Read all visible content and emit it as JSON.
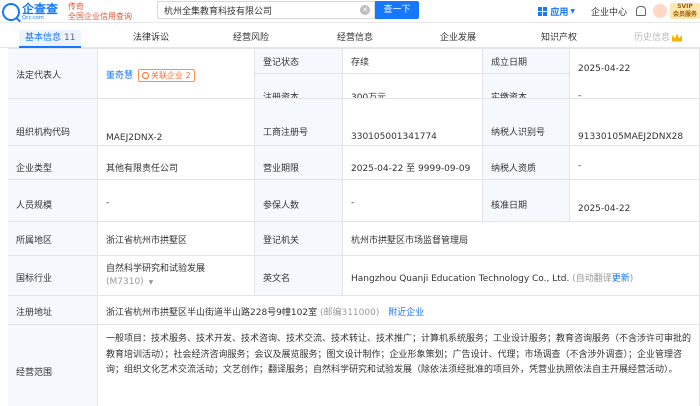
{
  "header": {
    "logo_cn": "企查查",
    "logo_en": "Qcc.com",
    "slogan_line1": "传奇",
    "slogan_line2": "全国企业信用查询",
    "search_value": "杭州全集教育科技有限公司",
    "clear_symbol": "✕",
    "search_button": "查一下",
    "apps_label": "应用",
    "center_label": "企业中心",
    "vip_line1": "SVIP",
    "vip_line2": "会员服务"
  },
  "tabs": [
    {
      "label": "基本信息",
      "count": "11"
    },
    {
      "label": "法律诉讼"
    },
    {
      "label": "经营风险"
    },
    {
      "label": "经营信息"
    },
    {
      "label": "企业发展"
    },
    {
      "label": "知识产权"
    },
    {
      "label": "历史信息"
    }
  ],
  "info": {
    "legal_rep_label": "法定代表人",
    "legal_rep_name": "董奇慧",
    "related_label": "关联企业",
    "related_count": "2",
    "reg_status_label": "登记状态",
    "reg_status": "存续",
    "est_date_label": "成立日期",
    "est_date": "2025-04-22",
    "reg_capital_label": "注册资本",
    "reg_capital": "300万元",
    "paid_capital_label": "实缴资本",
    "paid_capital": "-",
    "org_code_label": "组织机构代码",
    "org_code": "MAEJ2DNX-2",
    "biz_reg_label": "工商注册号",
    "biz_reg": "330105001341774",
    "taxpayer_id_label": "纳税人识别号",
    "taxpayer_id": "91330105MAEJ2DNX28",
    "type_label": "企业类型",
    "type": "其他有限责任公司",
    "term_label": "营业期限",
    "term": "2025-04-22 至 9999-09-09",
    "taxpayer_qual_label": "纳税人资质",
    "taxpayer_qual": "-",
    "staff_label": "人员规模",
    "staff": "-",
    "insured_label": "参保人数",
    "insured": "-",
    "approve_label": "核准日期",
    "approve": "2025-04-22",
    "region_label": "所属地区",
    "region": "浙江省杭州市拱墅区",
    "authority_label": "登记机关",
    "authority": "杭州市拱墅区市场监督管理局",
    "industry_label": "国标行业",
    "industry": "自然科学研究和试验发展",
    "industry_code": "(M7310)",
    "en_name_label": "英文名",
    "en_name": "Hangzhou Quanji Education Technology Co., Ltd.",
    "auto_translate": "(自动翻译",
    "update_label": "更新",
    "auto_translate_end": ")",
    "address_label": "注册地址",
    "address": "浙江省杭州市拱墅区半山街道半山路228号9幢102室",
    "postcode": "(邮编311000)",
    "nearby_label": "附近企业",
    "scope_label": "经营范围",
    "scope": "一般项目：技术服务、技术开发、技术咨询、技术交流、技术转让、技术推广；计算机系统服务；工业设计服务；教育咨询服务（不含涉许可审批的教育培训活动）；社会经济咨询服务；会议及展览服务；图文设计制作；企业形象策划；广告设计、代理；市场调查（不含涉外调查）；企业管理咨询；组织文化艺术交流活动；文艺创作；翻译服务；自然科学研究和试验发展（除依法须经批准的项目外，凭营业执照依法自主开展经营活动）。"
  },
  "colors": {
    "brand": "#1677ff",
    "label_bg": "#f5f8fd",
    "border": "#e4e4e4",
    "pill": "#ff6a2b"
  }
}
